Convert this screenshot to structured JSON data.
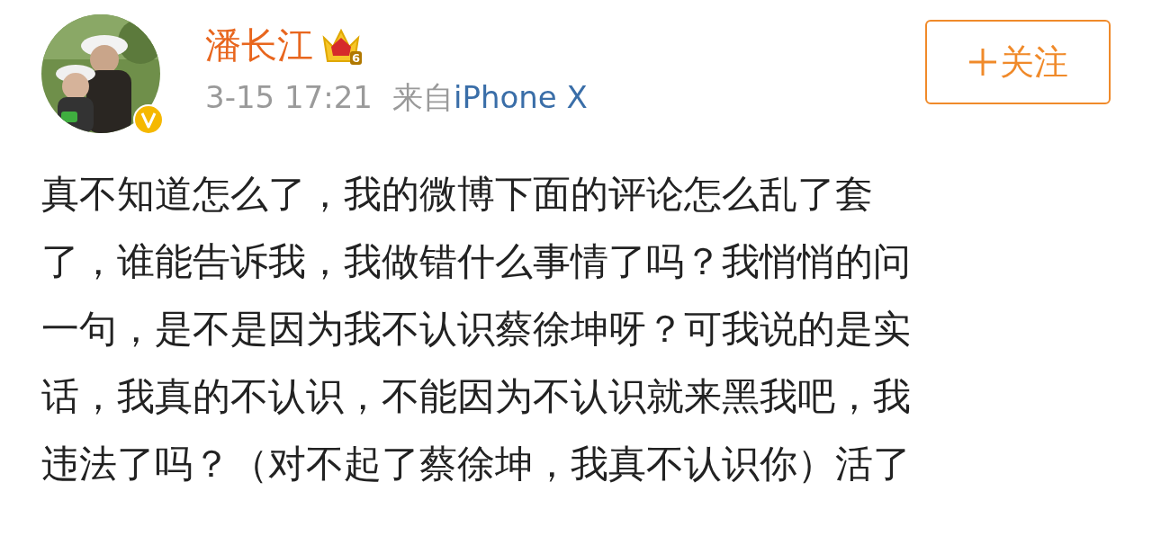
{
  "author": {
    "name": "潘长江",
    "vip_level": "6",
    "verified": true
  },
  "meta": {
    "time": "3-15 17:21",
    "source_prefix": "来自",
    "source": "iPhone X"
  },
  "follow_button": {
    "label": "关注"
  },
  "body_lines": [
    "真不知道怎么了，我的微博下面的评论怎么乱了套",
    "了，谁能告诉我，我做错什么事情了吗？我悄悄的问",
    "一句，是不是因为我不认识蔡徐坤呀？可我说的是实",
    "话，我真的不认识，不能因为不认识就来黑我吧，我",
    "违法了吗？（对不起了蔡徐坤，我真不认识你）活了"
  ]
}
